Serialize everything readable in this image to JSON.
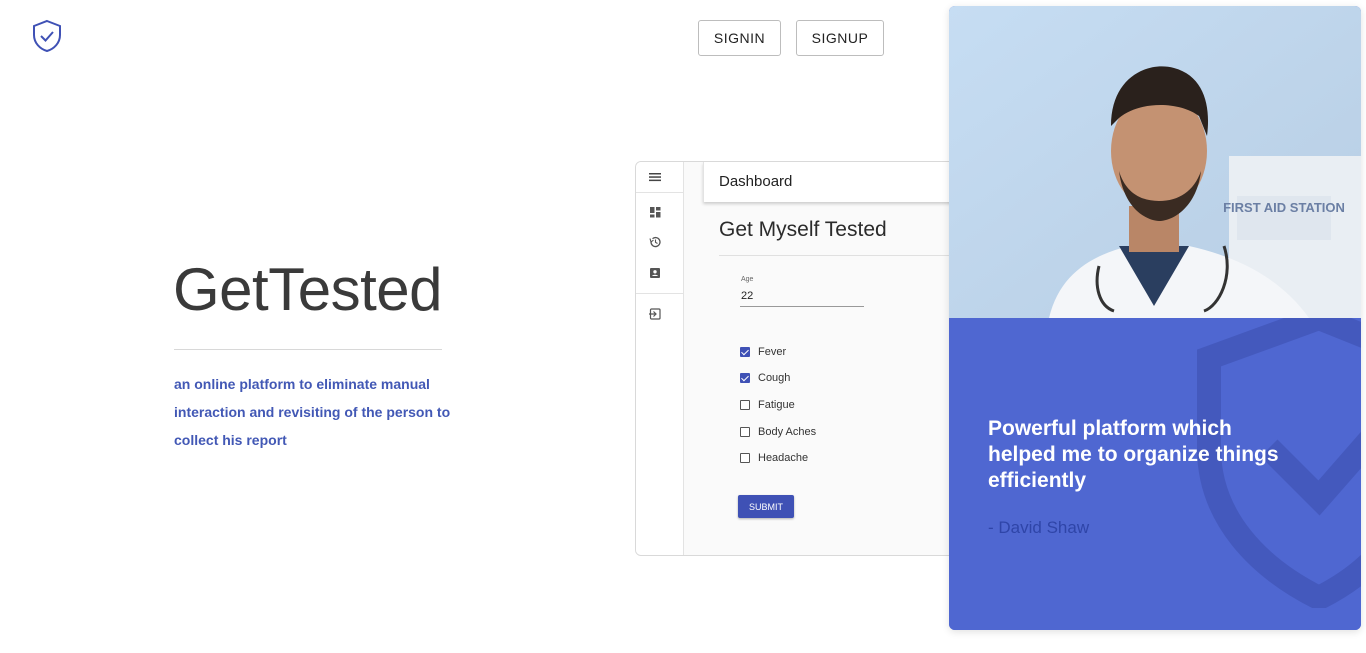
{
  "header": {
    "logo_icon": "shield-check-icon",
    "signin_label": "SIGNIN",
    "signup_label": "SIGNUP"
  },
  "hero": {
    "title": "GetTested",
    "description": "an online platform to eliminate manual interaction and revisiting of the person to collect his report"
  },
  "mockup": {
    "appbar_title": "Dashboard",
    "rail_icons": [
      "menu-icon",
      "dashboard-icon",
      "history-icon",
      "contact-card-icon",
      "logout-icon"
    ],
    "form_title": "Get Myself Tested",
    "age_label": "Age",
    "age_value": "22",
    "symptoms": [
      {
        "label": "Fever",
        "checked": true
      },
      {
        "label": "Cough",
        "checked": true
      },
      {
        "label": "Fatigue",
        "checked": false
      },
      {
        "label": "Body Aches",
        "checked": false
      },
      {
        "label": "Headache",
        "checked": false
      }
    ],
    "submit_label": "SUBMIT"
  },
  "testimonial": {
    "photo_sign_text": "FIRST AID STATION",
    "quote": "Powerful platform which helped me to organize things efficiently",
    "author": "- David Shaw"
  },
  "colors": {
    "accent": "#3f51b5",
    "hero_text": "#4258b5",
    "card_blue": "#4f67d1"
  }
}
